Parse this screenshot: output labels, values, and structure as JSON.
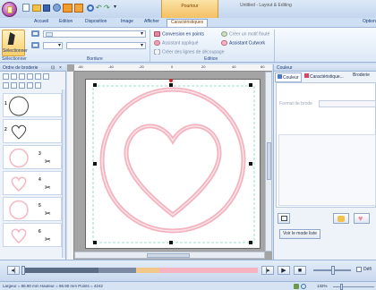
{
  "window": {
    "title": "Untitled - Layout & Editing",
    "context_group": "Pourtour",
    "options_label": "Option"
  },
  "tabs": [
    "Accueil",
    "Edition",
    "Disposition",
    "Image",
    "Afficher",
    "Caractéristiques"
  ],
  "ribbon": {
    "select_label": "Sélectionner",
    "groups": {
      "selection": "Sélectionner",
      "border": "Bordure",
      "edit": "Edition"
    },
    "edit_items": [
      "Conversion en points",
      "Assistant appliqué",
      "Créer des lignes de découpage"
    ],
    "edit_items2": [
      "Créer un motif flouté",
      "Assistant Cutwork"
    ]
  },
  "left_panel": {
    "title": "Ordre de broderie",
    "items": [
      {
        "num": "1",
        "has_scissors": false
      },
      {
        "num": "2",
        "has_scissors": false
      },
      {
        "num": "3",
        "has_scissors": true
      },
      {
        "num": "4",
        "has_scissors": true
      },
      {
        "num": "5",
        "has_scissors": true
      },
      {
        "num": "6",
        "has_scissors": true
      }
    ]
  },
  "canvas": {
    "ruler_marks": [
      "-60",
      "-40",
      "-20",
      "0",
      "20",
      "40",
      "60"
    ]
  },
  "right_panel": {
    "title": "Couleur",
    "tabs": [
      "Couleur",
      "Caractéristique...",
      "Broderie"
    ],
    "field_label": "Format de brode",
    "button_label": "Voir le mode liste"
  },
  "bottom": {
    "checkbox_label": "Défi"
  },
  "status": {
    "text": "Largeur = 86.90 mm  Hauteur = 86.90 mm  Points = 4242",
    "zoom": "132%"
  }
}
